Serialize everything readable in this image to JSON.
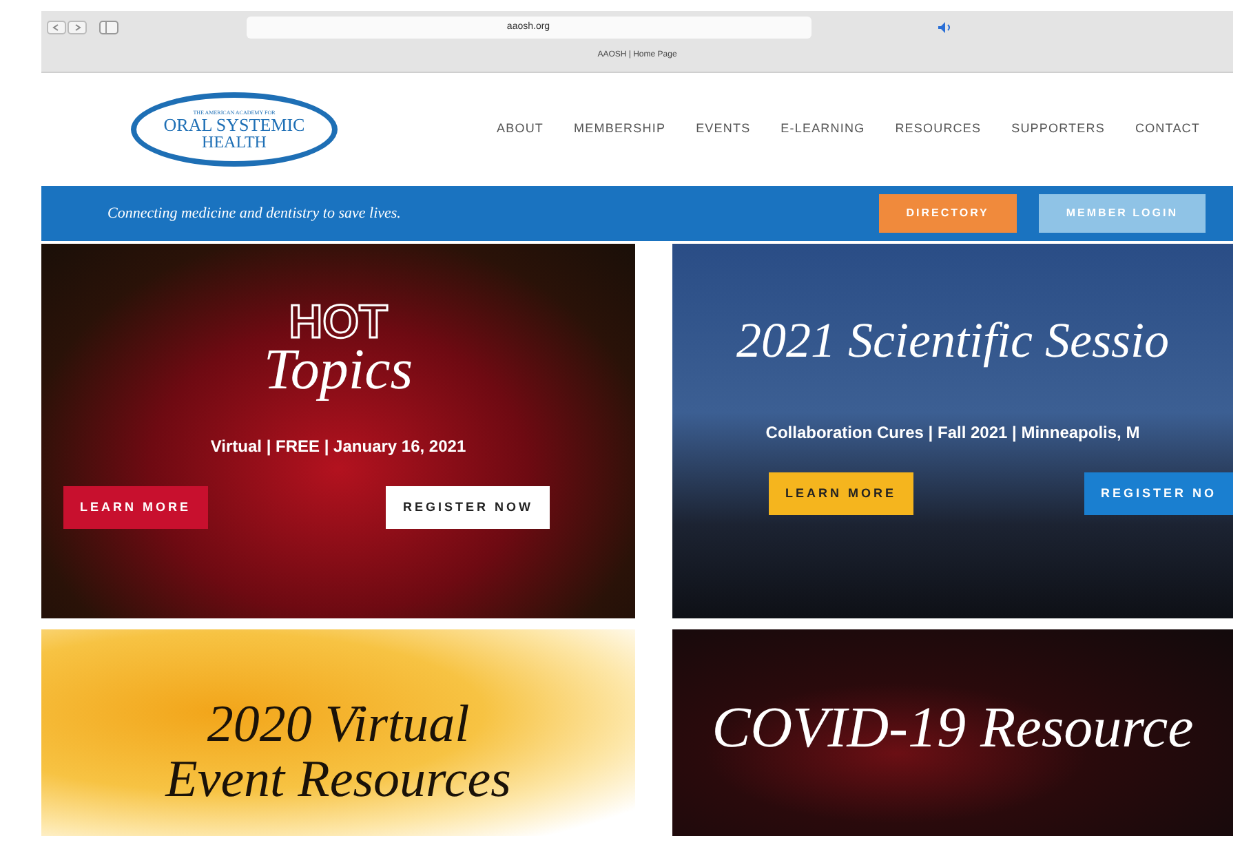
{
  "browser": {
    "address": "aaosh.org",
    "tab_title": "AAOSH | Home Page"
  },
  "header": {
    "logo": {
      "line_1": "THE AMERICAN ACADEMY FOR",
      "line_2": "ORAL SYSTEMIC",
      "line_3": "HEALTH"
    },
    "nav": [
      {
        "label": "ABOUT"
      },
      {
        "label": "MEMBERSHIP"
      },
      {
        "label": "EVENTS"
      },
      {
        "label": "E-LEARNING"
      },
      {
        "label": "RESOURCES"
      },
      {
        "label": "SUPPORTERS"
      },
      {
        "label": "CONTACT"
      }
    ]
  },
  "tagline_bar": {
    "tagline": "Connecting medicine and dentistry to save lives.",
    "buttons": [
      {
        "label": "DIRECTORY",
        "color": "#f08a3c"
      },
      {
        "label": "MEMBER LOGIN",
        "color": "#8fc3e6"
      }
    ]
  },
  "tiles": [
    {
      "kind": "stage",
      "titles": [
        "HOT",
        "Topics"
      ],
      "subtitle": "Virtual | FREE | January 16, 2021",
      "buttons": [
        {
          "label": "LEARN MORE",
          "color": "#c8102e"
        },
        {
          "label": "REGISTER NOW",
          "color": "#ffffff"
        }
      ]
    },
    {
      "kind": "city",
      "titles": [
        "2021 Scientific Sessio"
      ],
      "subtitle": "Collaboration Cures | Fall 2021 | Minneapolis, M",
      "buttons": [
        {
          "label": "LEARN MORE",
          "color": "#f5b51e"
        },
        {
          "label": "REGISTER NO",
          "color": "#1a7fd0"
        }
      ]
    },
    {
      "kind": "watercolor",
      "titles": [
        "2020 Virtual",
        "Event Resources"
      ]
    },
    {
      "kind": "virus",
      "titles": [
        "COVID-19 Resource"
      ]
    }
  ]
}
